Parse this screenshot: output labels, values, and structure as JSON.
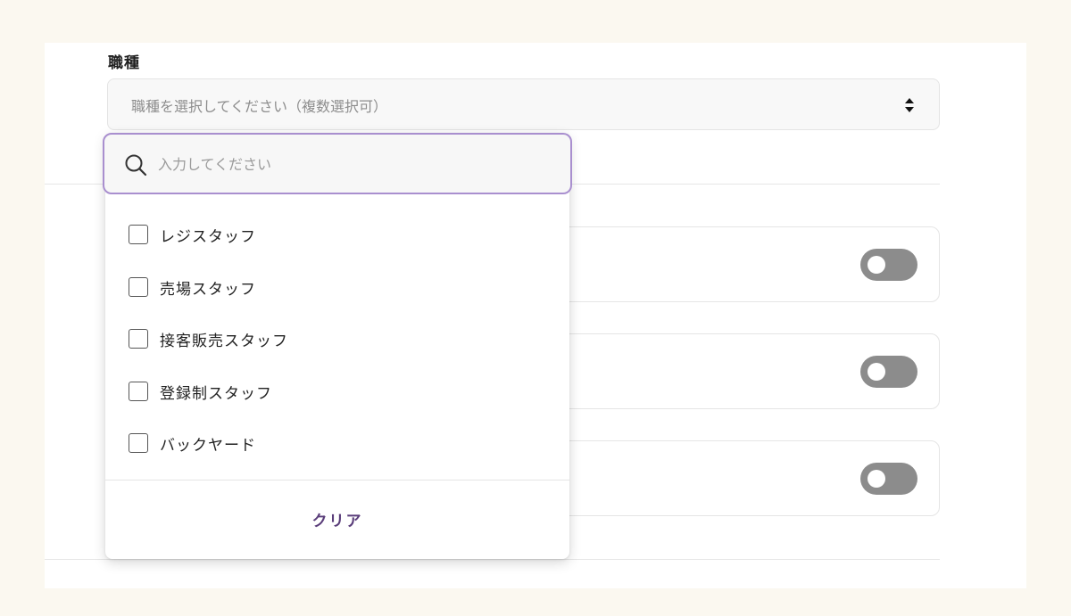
{
  "field": {
    "label": "職種",
    "placeholder": "職種を選択してください（複数選択可）"
  },
  "dropdown": {
    "search_placeholder": "入力してください",
    "options": [
      {
        "label": "レジスタッフ",
        "checked": false
      },
      {
        "label": "売場スタッフ",
        "checked": false
      },
      {
        "label": "接客販売スタッフ",
        "checked": false
      },
      {
        "label": "登録制スタッフ",
        "checked": false
      },
      {
        "label": "バックヤード",
        "checked": false
      }
    ],
    "clear_label": "クリア"
  },
  "toggles": [
    {
      "on": false
    },
    {
      "on": false
    },
    {
      "on": false
    }
  ],
  "colors": {
    "accent": "#a98fcf",
    "clear_text": "#5a3d7a",
    "toggle_off": "#8c8c8c"
  }
}
